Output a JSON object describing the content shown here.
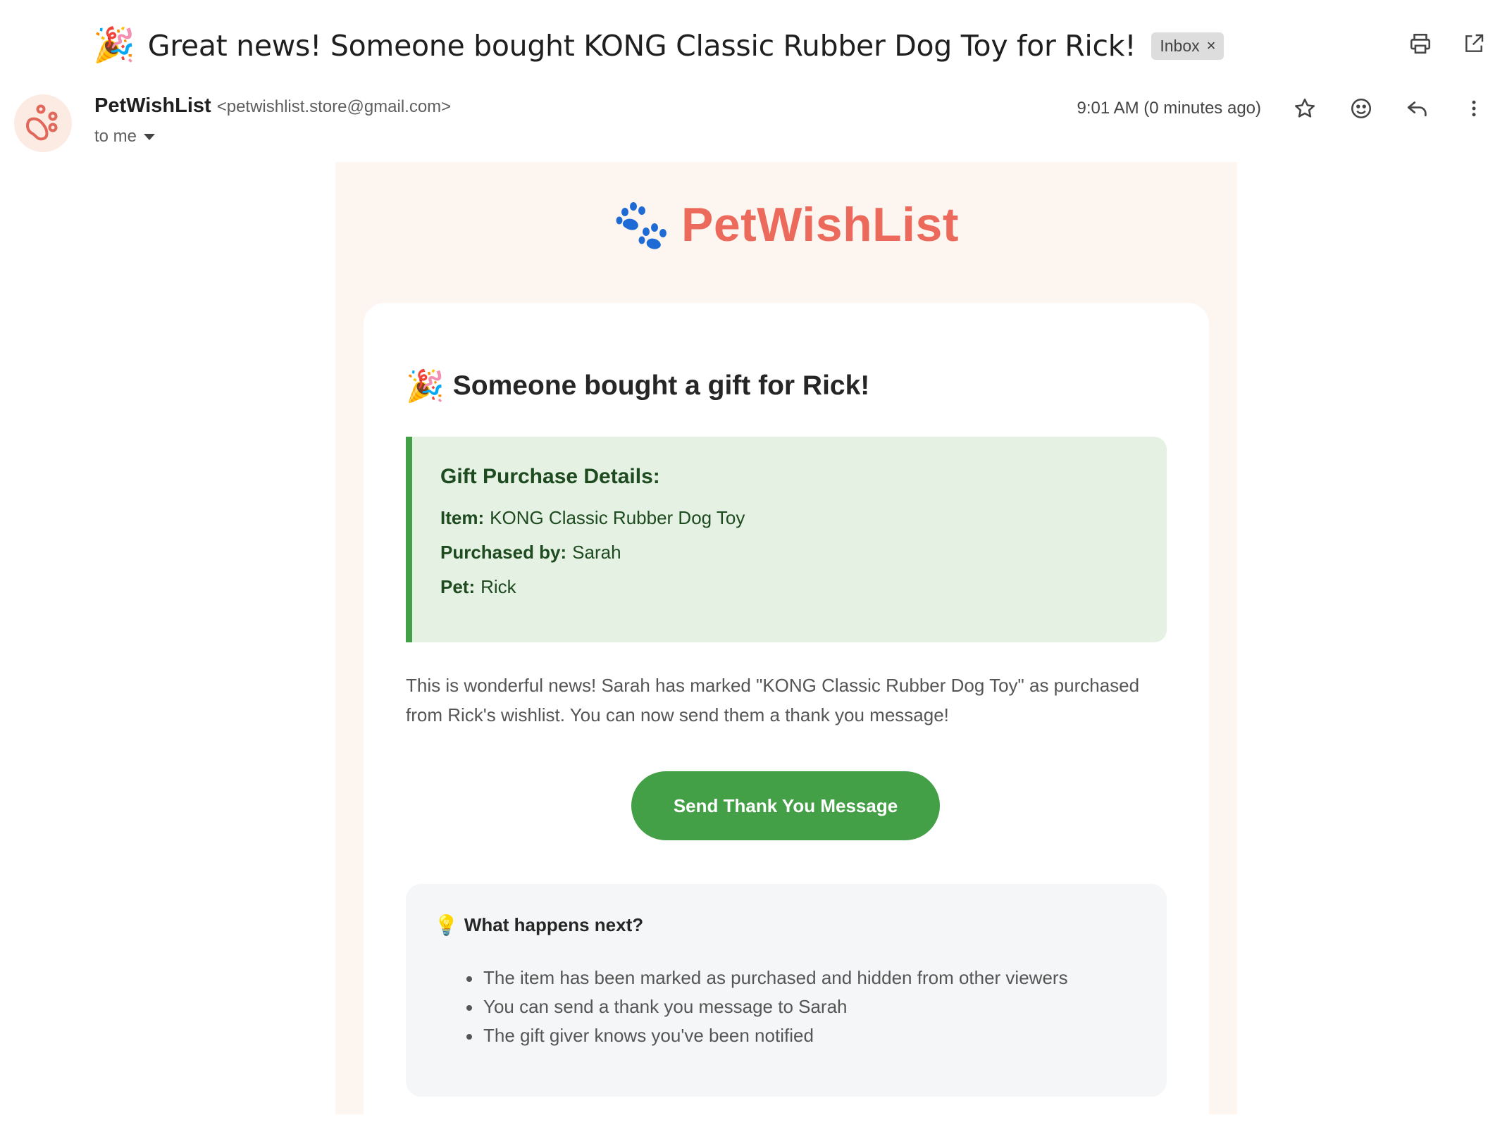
{
  "subject": {
    "emoji": "🎉",
    "text": "Great news! Someone bought KONG Classic Rubber Dog Toy for Rick!",
    "label_chip": "Inbox",
    "label_remove": "×"
  },
  "toolbar": {
    "icons": [
      "print-icon",
      "open-in-new-window-icon"
    ]
  },
  "sender": {
    "name": "PetWishList",
    "email": "<petwishlist.store@gmail.com>",
    "recipient": "to me",
    "time": "9:01 AM (0 minutes ago)",
    "actions": [
      "star-icon",
      "emoji-icon",
      "reply-icon",
      "more-options-icon"
    ]
  },
  "email": {
    "brand": "PetWishList",
    "title_emoji": "🎉",
    "title": "Someone bought a gift for Rick!",
    "details": {
      "heading": "Gift Purchase Details:",
      "item_label": "Item:",
      "item_value": "KONG Classic Rubber Dog Toy",
      "purchaser_label": "Purchased by:",
      "purchaser_value": "Sarah",
      "pet_label": "Pet:",
      "pet_value": "Rick"
    },
    "paragraph": "This is wonderful news! Sarah has marked \"KONG Classic Rubber Dog Toy\" as purchased from Rick's wishlist. You can now send them a thank you message!",
    "button_label": "Send Thank You Message",
    "next": {
      "emoji": "💡",
      "heading": "What happens next?",
      "items": [
        "The item has been marked as purchased and hidden from other viewers",
        "You can send a thank you message to Sarah",
        "The gift giver knows you've been notified"
      ]
    }
  },
  "colors": {
    "brand": "#ec6a5c",
    "button": "#44a047",
    "details_bg": "#e5f1e3",
    "email_bg": "#fdf5f0"
  }
}
